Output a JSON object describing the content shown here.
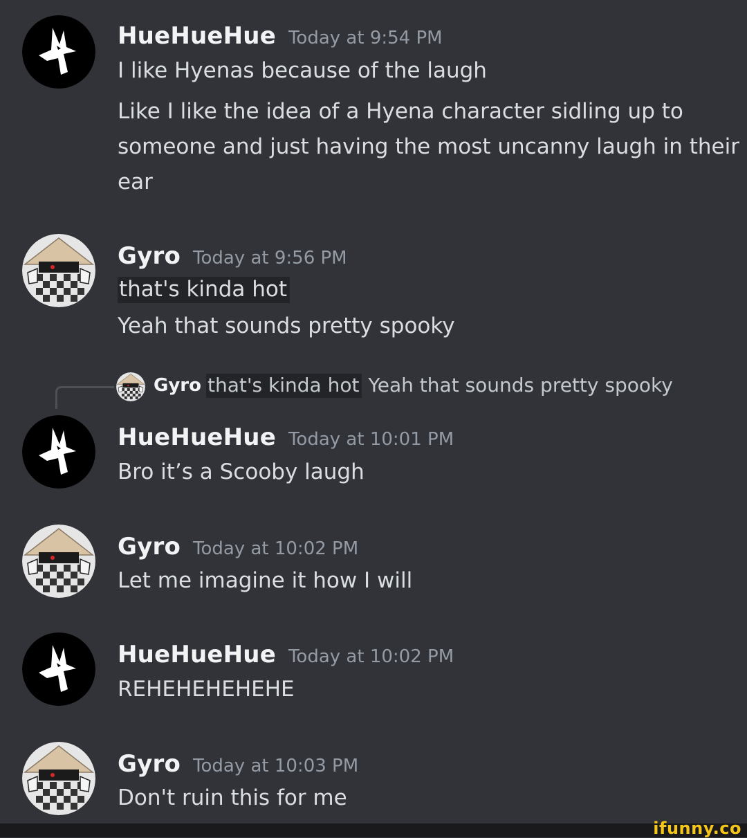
{
  "messages": [
    {
      "author": "HueHueHue",
      "timestamp": "Today at 9:54 PM",
      "avatar": "fox-avatar",
      "lines": [
        "I like Hyenas because of the laugh",
        "Like I like the idea of a Hyena character sidling up to",
        "someone and just having the most uncanny laugh in their",
        "ear"
      ]
    },
    {
      "author": "Gyro",
      "timestamp": "Today at 9:56 PM",
      "avatar": "straw-hat-avatar",
      "lines": [
        "that's kinda hot",
        "Yeah that sounds pretty spooky"
      ]
    },
    {
      "author": "HueHueHue",
      "timestamp": "Today at 10:01 PM",
      "avatar": "fox-avatar",
      "reply": {
        "author": "Gyro",
        "highlight": "that's kinda hot",
        "text": "Yeah that sounds pretty spooky"
      },
      "lines": [
        "Bro it’s a Scooby laugh"
      ]
    },
    {
      "author": "Gyro",
      "timestamp": "Today at 10:02 PM",
      "avatar": "straw-hat-avatar",
      "lines": [
        "Let me imagine it how I will"
      ]
    },
    {
      "author": "HueHueHue",
      "timestamp": "Today at 10:02 PM",
      "avatar": "fox-avatar",
      "lines": [
        "REHEHEHEHEHE"
      ]
    },
    {
      "author": "Gyro",
      "timestamp": "Today at 10:03 PM",
      "avatar": "straw-hat-avatar",
      "lines": [
        "Don't ruin this for me"
      ]
    }
  ],
  "watermark": "ifunny.co",
  "colors": {
    "background": "#313338",
    "username": "#f2f3f5",
    "timestamp": "#949ba4",
    "text": "#dbdee1",
    "watermark": "#f5c518"
  }
}
